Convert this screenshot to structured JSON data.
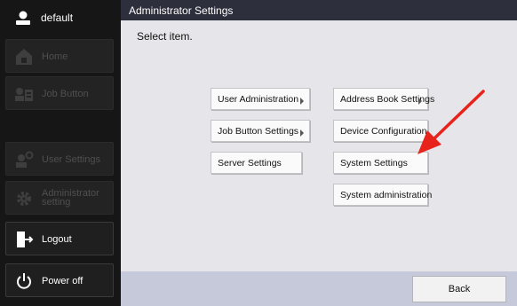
{
  "user": {
    "name": "default"
  },
  "sidebar": {
    "items": [
      {
        "label": "Home",
        "icon": "home-icon",
        "enabled": false
      },
      {
        "label": "Job Button",
        "icon": "job-button-icon",
        "enabled": false
      },
      {
        "label": "User Settings",
        "icon": "user-settings-icon",
        "enabled": false
      },
      {
        "label": "Administrator\nsetting",
        "icon": "gear-icon",
        "enabled": false
      },
      {
        "label": "Logout",
        "icon": "logout-icon",
        "enabled": true
      },
      {
        "label": "Power off",
        "icon": "power-icon",
        "enabled": true
      }
    ]
  },
  "header": {
    "title": "Administrator Settings"
  },
  "main": {
    "prompt": "Select item.",
    "buttons": [
      {
        "label": "User Administration",
        "has_submenu": true
      },
      {
        "label": "Address Book Settings",
        "has_submenu": true
      },
      {
        "label": "Job Button Settings",
        "has_submenu": true
      },
      {
        "label": "Device Configuration",
        "has_submenu": false
      },
      {
        "label": "Server Settings",
        "has_submenu": false
      },
      {
        "label": "System Settings",
        "has_submenu": false
      },
      {
        "label": "System administration",
        "has_submenu": false
      }
    ]
  },
  "footer": {
    "back_label": "Back"
  },
  "colors": {
    "title_bar": "#2d2f3c",
    "content_bg": "#e6e6ea",
    "footer_bg": "#c6c9d9",
    "annotation_arrow": "#e8231c"
  }
}
